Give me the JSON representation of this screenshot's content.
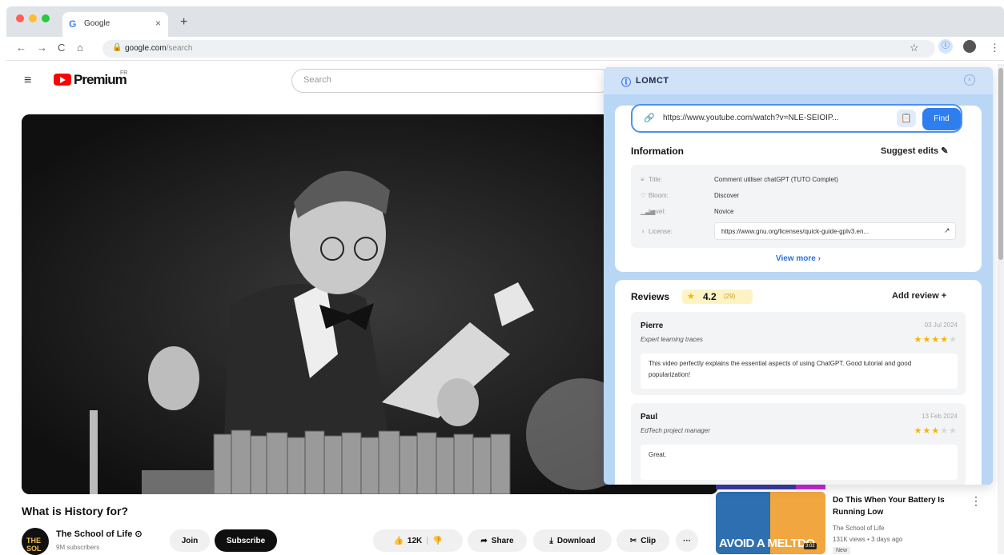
{
  "browser": {
    "tab": {
      "favicon": "G",
      "title": "Google",
      "close": "×"
    },
    "new_tab": "+",
    "nav": {
      "back": "←",
      "forward": "→",
      "reload": "C",
      "home": "⌂"
    },
    "address": {
      "domain": "google.com",
      "path": "/search"
    },
    "menu": "⋮"
  },
  "youtube": {
    "logo_text": "Premium",
    "region": "FR",
    "search_placeholder": "Search",
    "video_title": "What is History for?",
    "channel": {
      "avatar_text": "THE SOL",
      "name": "The School of Life",
      "verified": "⊙",
      "subscribers": "9M subscribers"
    },
    "actions": {
      "join": "Join",
      "subscribe": "Subscribe",
      "likes": "12K",
      "share": "Share",
      "download": "Download",
      "clip": "Clip",
      "more": "···"
    },
    "recommendation": {
      "thumb_caption": "AVOID A MELTDO",
      "duration": "3:02",
      "title": "Do This When Your Battery Is Running Low",
      "channel": "The School of Life",
      "meta": "131K views • 3 days ago",
      "badge": "New"
    }
  },
  "extension": {
    "brand": "LOMCT",
    "close": "×",
    "url_input": "https://www.youtube.com/watch?v=NLE-SEIOIP...",
    "find_label": "Find",
    "information": {
      "heading": "Information",
      "suggest_label": "Suggest edits",
      "rows": [
        {
          "label": "Title:",
          "value": "Comment utiliser chatGPT (TUTO Complet)"
        },
        {
          "label": "Bloom:",
          "value": "Discover"
        },
        {
          "label": "Level:",
          "value": "Novice"
        },
        {
          "label": "License:",
          "value": "https://www.gnu.org/licenses/quick-guide-gplv3.en..."
        }
      ],
      "view_more": "View more ›"
    },
    "reviews": {
      "heading": "Reviews",
      "rating": "4.2",
      "count": "(29)",
      "add_label": "Add review +",
      "items": [
        {
          "name": "Pierre",
          "date": "03 Jul 2024",
          "role": "Expert learning traces",
          "stars": 4,
          "text": "This video perfectly explains the essential aspects of using ChatGPT. Good tutorial and good popularization!"
        },
        {
          "name": "Paul",
          "date": "13 Feb 2024",
          "role": "EdTech project manager",
          "stars": 3,
          "text": "Great."
        }
      ]
    }
  },
  "colors": {
    "accent": "#2f7ef0",
    "panel_bg": "#b9d6f5",
    "yt_red": "#ff0000",
    "star": "#f5b400"
  }
}
